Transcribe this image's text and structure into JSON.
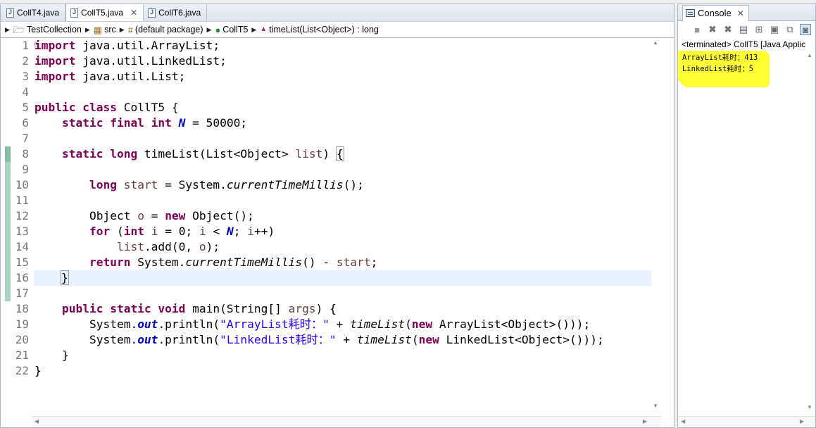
{
  "editor": {
    "tabs": [
      {
        "label": "CollT4.java",
        "active": false
      },
      {
        "label": "CollT5.java",
        "active": true
      },
      {
        "label": "CollT6.java",
        "active": false
      }
    ],
    "breadcrumb": {
      "project": "TestCollection",
      "folder": "src",
      "package": "(default package)",
      "class": "CollT5",
      "method": "timeList(List<Object>) : long"
    },
    "line_numbers": [
      "1",
      "2",
      "3",
      "4",
      "5",
      "6",
      "7",
      "8",
      "9",
      "10",
      "11",
      "12",
      "13",
      "14",
      "15",
      "16",
      "17",
      "18",
      "19",
      "20",
      "21",
      "22"
    ],
    "current_line": 16,
    "changed_lines": [
      8,
      16
    ]
  },
  "console": {
    "tab_label": "Console",
    "status": "<terminated> CollT5 [Java Applic",
    "output": [
      "ArrayList耗时：413",
      "LinkedList耗时：5"
    ],
    "highlight_color": "#ffff33"
  },
  "colors": {
    "keyword": "#7f0055",
    "string": "#2a00ff",
    "field": "#0000c0",
    "local_var": "#6a3e3e",
    "current_line_bg": "#e8f2fe",
    "change_marker": "#7fbfa8"
  }
}
